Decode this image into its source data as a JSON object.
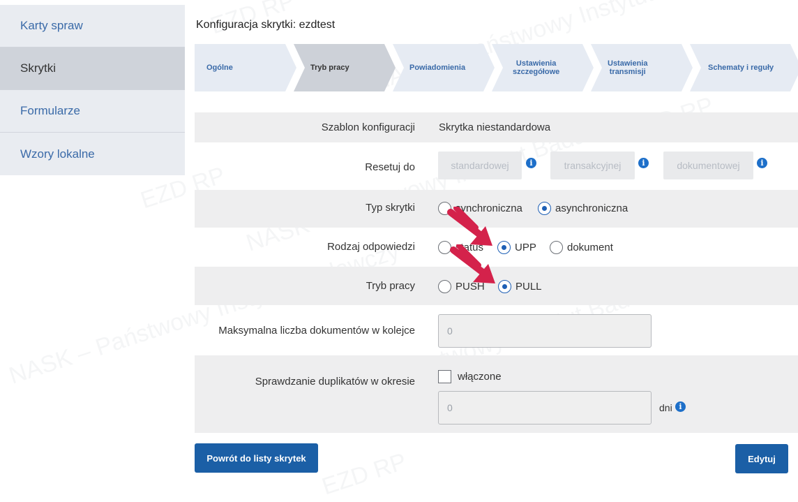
{
  "sidebar": {
    "items": [
      {
        "label": "Karty spraw"
      },
      {
        "label": "Skrytki"
      },
      {
        "label": "Formularze"
      },
      {
        "label": "Wzory lokalne"
      }
    ]
  },
  "header": {
    "title": "Konfiguracja skrytki: ezdtest"
  },
  "steps": [
    {
      "label": "Ogólne"
    },
    {
      "label": "Tryb pracy"
    },
    {
      "label": "Powiadomienia"
    },
    {
      "line1": "Ustawienia",
      "line2": "szczegółowe"
    },
    {
      "line1": "Ustawienia",
      "line2": "transmisji"
    },
    {
      "label": "Schematy i reguły"
    }
  ],
  "form": {
    "template": {
      "label": "Szablon konfiguracji",
      "value": "Skrytka niestandardowa"
    },
    "reset": {
      "label": "Resetuj do",
      "buttons": [
        "standardowej",
        "transakcyjnej",
        "dokumentowej"
      ],
      "info_glyph": "i"
    },
    "box_type": {
      "label": "Typ skrytki",
      "options": [
        "synchroniczna",
        "asynchroniczna"
      ],
      "selected": "asynchroniczna"
    },
    "response_type": {
      "label": "Rodzaj odpowiedzi",
      "options": [
        "status",
        "UPP",
        "dokument"
      ],
      "selected": "UPP"
    },
    "work_mode": {
      "label": "Tryb pracy",
      "options": [
        "PUSH",
        "PULL"
      ],
      "selected": "PULL"
    },
    "max_docs": {
      "label": "Maksymalna liczba dokumentów w kolejce",
      "value": "0"
    },
    "duplicates": {
      "label": "Sprawdzanie duplikatów w okresie",
      "checkbox_label": "włączone",
      "checked": false,
      "value": "0",
      "unit": "dni"
    }
  },
  "actions": {
    "back_label": "Powrót do listy skrytek",
    "edit_label": "Edytuj"
  },
  "watermark": {
    "texts": [
      "EZD RP",
      "NASK – Państwowy Instytut Badawczy"
    ]
  },
  "colors": {
    "primary": "#1b5fa6",
    "info": "#1d6fc9",
    "arrow": "#d4224b",
    "sidebar_link": "#3a6aa8"
  }
}
